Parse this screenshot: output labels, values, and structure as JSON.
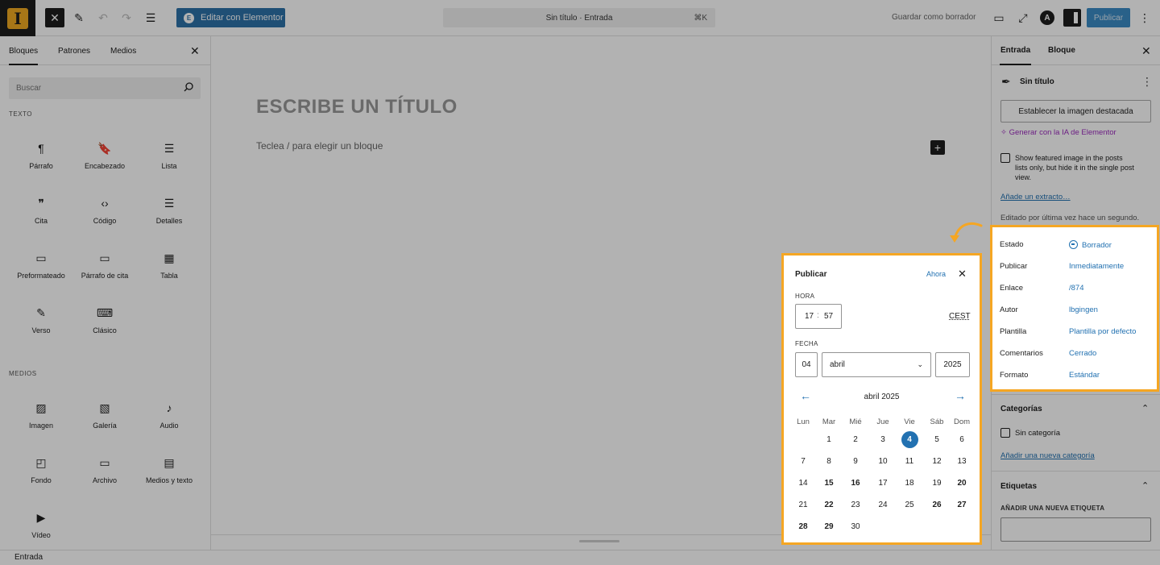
{
  "topbar": {
    "logo_letter": "I",
    "elementor_label": "Editar con Elementor",
    "command_title": "Sin título · Entrada",
    "command_shortcut": "⌘K",
    "save_draft": "Guardar como borrador",
    "publish": "Publicar"
  },
  "inserter": {
    "tabs": [
      "Bloques",
      "Patrones",
      "Medios"
    ],
    "search_placeholder": "Buscar",
    "text_category": "TEXTO",
    "text_blocks": [
      {
        "label": "Párrafo",
        "icon": "¶"
      },
      {
        "label": "Encabezado",
        "icon": "🔖"
      },
      {
        "label": "Lista",
        "icon": "☰"
      },
      {
        "label": "Cita",
        "icon": "❞"
      },
      {
        "label": "Código",
        "icon": "‹›"
      },
      {
        "label": "Detalles",
        "icon": "☰"
      },
      {
        "label": "Preformateado",
        "icon": "▭"
      },
      {
        "label": "Párrafo de cita",
        "icon": "▭"
      },
      {
        "label": "Tabla",
        "icon": "▦"
      },
      {
        "label": "Verso",
        "icon": "✎"
      },
      {
        "label": "Clásico",
        "icon": "⌨"
      }
    ],
    "media_category": "MEDIOS",
    "media_blocks": [
      {
        "label": "Imagen",
        "icon": "▨"
      },
      {
        "label": "Galería",
        "icon": "▧"
      },
      {
        "label": "Audio",
        "icon": "♪"
      },
      {
        "label": "Fondo",
        "icon": "◰"
      },
      {
        "label": "Archivo",
        "icon": "▭"
      },
      {
        "label": "Medios y texto",
        "icon": "▤"
      },
      {
        "label": "Vídeo",
        "icon": "▶"
      }
    ]
  },
  "canvas": {
    "title_placeholder": "ESCRIBE UN TÍTULO",
    "block_hint": "Teclea / para elegir un bloque"
  },
  "settings": {
    "tabs": [
      "Entrada",
      "Bloque"
    ],
    "doc_title": "Sin título",
    "featured_button": "Establecer la imagen destacada",
    "ai_link": "✧ Generar con la IA de Elementor",
    "featured_option": "Show featured image in the posts lists only, but hide it in the single post view.",
    "excerpt_link": "Añade un extracto…",
    "last_edited": "Editado por última vez hace un segundo.",
    "meta": [
      {
        "key": "Estado",
        "value": "Borrador"
      },
      {
        "key": "Publicar",
        "value": "Inmediatamente"
      },
      {
        "key": "Enlace",
        "value": "/874"
      },
      {
        "key": "Autor",
        "value": "lbgingen"
      },
      {
        "key": "Plantilla",
        "value": "Plantilla por defecto"
      },
      {
        "key": "Comentarios",
        "value": "Cerrado"
      },
      {
        "key": "Formato",
        "value": "Estándar"
      }
    ],
    "categories_title": "Categorías",
    "uncategorized": "Sin categoría",
    "new_category": "Añadir una nueva categoría",
    "tags_title": "Etiquetas",
    "new_tag_label": "AÑADIR UNA NUEVA ETIQUETA"
  },
  "publish_popover": {
    "title": "Publicar",
    "now_label": "Ahora",
    "time_label": "HORA",
    "hour": "17",
    "minute": "57",
    "timezone": "CEST",
    "date_label": "FECHA",
    "day": "04",
    "month": "abril",
    "year": "2025",
    "calendar_title": "abril 2025",
    "weekdays": [
      "Lun",
      "Mar",
      "Mié",
      "Jue",
      "Vie",
      "Sáb",
      "Dom"
    ],
    "first_weekday_offset": 1,
    "days_in_month": 30,
    "selected_day": 4,
    "bold_days": [
      15,
      16,
      20,
      22,
      26,
      27,
      28,
      29
    ]
  },
  "statusbar": {
    "label": "Entrada"
  },
  "colors": {
    "highlight": "#f5a623",
    "accent": "#2271b1",
    "elementor": "#2d72a8",
    "ai": "#9b2bbd"
  }
}
